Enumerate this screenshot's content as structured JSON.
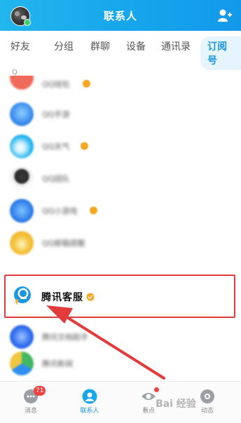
{
  "header": {
    "title": "联系人",
    "avatar_icon": "user-avatar",
    "add_icon": "add-contact-icon",
    "color": "#1aa6ec"
  },
  "tabs": [
    {
      "label": "好友",
      "active": false
    },
    {
      "label": "分组",
      "active": false
    },
    {
      "label": "群聊",
      "active": false
    },
    {
      "label": "设备",
      "active": false
    },
    {
      "label": "通讯录",
      "active": false
    },
    {
      "label": "订阅号",
      "active": true
    }
  ],
  "section_letter": "Q",
  "list": [
    {
      "label": "QQ钱包",
      "icon": "qq-wallet-icon",
      "verified": true,
      "color": "#f06a5a"
    },
    {
      "label": "QQ手游",
      "icon": "qq-games-icon",
      "verified": false,
      "color": "#3e8ff0"
    },
    {
      "label": "QQ天气",
      "icon": "qq-weather-icon",
      "verified": true,
      "color": "#22b5ee"
    },
    {
      "label": "QQ团队",
      "icon": "qq-team-icon",
      "verified": false,
      "color": "#3a3a3a"
    },
    {
      "label": "QQ小游戏",
      "icon": "qq-minigame-icon",
      "verified": true,
      "color": "#2e7ee8"
    },
    {
      "label": "QQ邮箱提醒",
      "icon": "qq-mail-icon",
      "verified": false,
      "color": "#f5b52d"
    },
    {
      "label": "腾讯客服",
      "icon": "tencent-service-icon",
      "verified": true,
      "color": "#1a97e3"
    },
    {
      "label": "腾讯文档助手",
      "icon": "tencent-docs-icon",
      "verified": false,
      "color": "#2f6df0"
    },
    {
      "label": "腾讯新闻",
      "icon": "tencent-news-icon",
      "verified": false,
      "color": "#42b862"
    }
  ],
  "bottom_nav": [
    {
      "label": "消息",
      "icon": "message-icon",
      "badge": "71"
    },
    {
      "label": "联系人",
      "icon": "contacts-icon",
      "active": true
    },
    {
      "label": "看点",
      "icon": "watch-icon",
      "dot": true
    },
    {
      "label": "动态",
      "icon": "feed-icon"
    }
  ],
  "watermark": "Bai 经验",
  "annotation": {
    "box_color": "#e23b3b",
    "arrow_color": "#e23b3b"
  }
}
